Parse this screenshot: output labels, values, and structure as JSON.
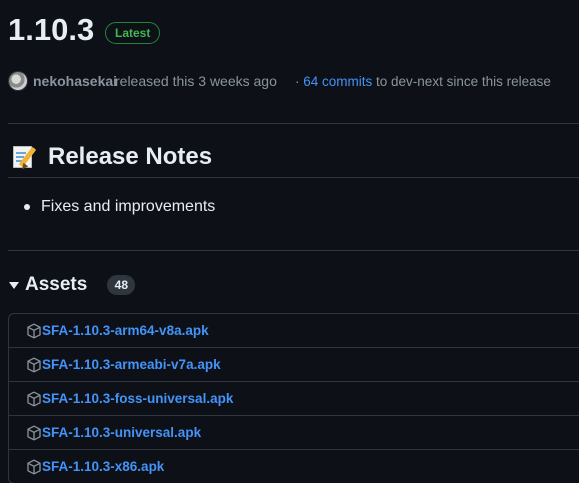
{
  "release": {
    "version": "1.10.3",
    "badge": "Latest",
    "author": "nekohasekai",
    "released_text": "released this 3 weeks ago",
    "commits_prefix": "· ",
    "commits_link": "64 commits",
    "commits_suffix": " to dev-next since this release"
  },
  "notes": {
    "icon": "memo-icon",
    "title": "Release Notes",
    "items": [
      "Fixes and improvements"
    ]
  },
  "assets": {
    "title": "Assets",
    "count": "48",
    "files": [
      "SFA-1.10.3-arm64-v8a.apk",
      "SFA-1.10.3-armeabi-v7a.apk",
      "SFA-1.10.3-foss-universal.apk",
      "SFA-1.10.3-universal.apk",
      "SFA-1.10.3-x86.apk"
    ]
  },
  "colors": {
    "background": "#0d1117",
    "link": "#4493f8",
    "badge_green": "#3fb950",
    "muted": "#8b949e",
    "border": "#30363d"
  }
}
